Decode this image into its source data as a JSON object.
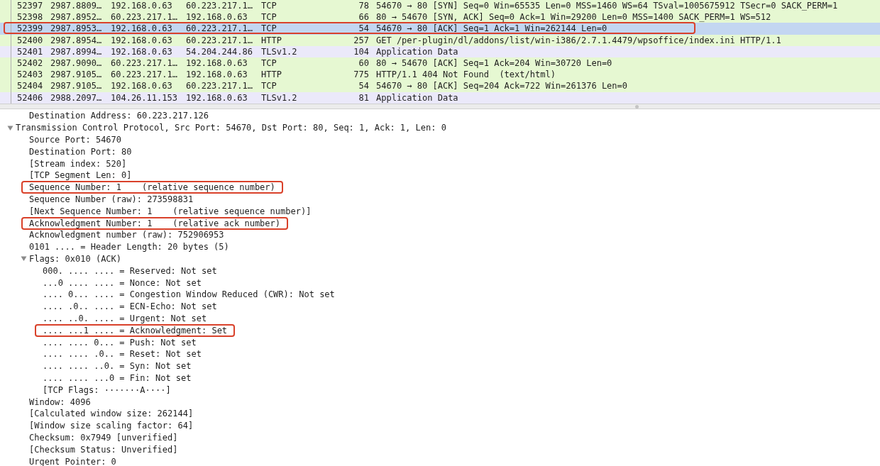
{
  "packets": [
    {
      "no": "52397",
      "time": "2987.8809…",
      "source": "192.168.0.63",
      "destination": "60.223.217.1…",
      "protocol": "TCP",
      "length": "78",
      "info": "54670 → 80 [SYN] Seq=0 Win=65535 Len=0 MSS=1460 WS=64 TSval=1005675912 TSecr=0 SACK_PERM=1",
      "color": "#e6f8d2",
      "selected": false,
      "highlighted": false
    },
    {
      "no": "52398",
      "time": "2987.8952…",
      "source": "60.223.217.1…",
      "destination": "192.168.0.63",
      "protocol": "TCP",
      "length": "66",
      "info": "80 → 54670 [SYN, ACK] Seq=0 Ack=1 Win=29200 Len=0 MSS=1400 SACK_PERM=1 WS=512",
      "color": "#e6f8d2",
      "selected": false,
      "highlighted": false
    },
    {
      "no": "52399",
      "time": "2987.8953…",
      "source": "192.168.0.63",
      "destination": "60.223.217.1…",
      "protocol": "TCP",
      "length": "54",
      "info": "54670 → 80 [ACK] Seq=1 Ack=1 Win=262144 Len=0",
      "selected": true,
      "highlighted": true
    },
    {
      "no": "52400",
      "time": "2987.8954…",
      "source": "192.168.0.63",
      "destination": "60.223.217.1…",
      "protocol": "HTTP",
      "length": "257",
      "info": "GET /per-plugin/dl/addons/list/win-i386/2.7.1.4479/wpsoffice/index.ini HTTP/1.1",
      "color": "#e6f8d2",
      "selected": false,
      "highlighted": false
    },
    {
      "no": "52401",
      "time": "2987.8994…",
      "source": "192.168.0.63",
      "destination": "54.204.244.86",
      "protocol": "TLSv1.2",
      "length": "104",
      "info": "Application Data",
      "color": "#ebe9fa",
      "selected": false,
      "highlighted": false
    },
    {
      "no": "52402",
      "time": "2987.9090…",
      "source": "60.223.217.1…",
      "destination": "192.168.0.63",
      "protocol": "TCP",
      "length": "60",
      "info": "80 → 54670 [ACK] Seq=1 Ack=204 Win=30720 Len=0",
      "color": "#e6f8d2",
      "selected": false,
      "highlighted": false
    },
    {
      "no": "52403",
      "time": "2987.9105…",
      "source": "60.223.217.1…",
      "destination": "192.168.0.63",
      "protocol": "HTTP",
      "length": "775",
      "info": "HTTP/1.1 404 Not Found  (text/html)",
      "color": "#e6f8d2",
      "selected": false,
      "highlighted": false
    },
    {
      "no": "52404",
      "time": "2987.9105…",
      "source": "192.168.0.63",
      "destination": "60.223.217.1…",
      "protocol": "TCP",
      "length": "54",
      "info": "54670 → 80 [ACK] Seq=204 Ack=722 Win=261376 Len=0",
      "color": "#e6f8d2",
      "selected": false,
      "highlighted": false
    },
    {
      "no": "52406",
      "time": "2988.2097…",
      "source": "104.26.11.153",
      "destination": "192.168.0.63",
      "protocol": "TLSv1.2",
      "length": "81",
      "info": "Application Data",
      "color": "#ebe9fa",
      "selected": false,
      "highlighted": false
    }
  ],
  "details": [
    {
      "children": [
        {
          "text": "Destination Address: 60.223.217.126",
          "highlighted": false
        }
      ]
    },
    {
      "text": "Transmission Control Protocol, Src Port: 54670, Dst Port: 80, Seq: 1, Ack: 1, Len: 0",
      "highlighted": false,
      "expanded": true,
      "children": [
        {
          "text": "Source Port: 54670",
          "highlighted": false
        },
        {
          "text": "Destination Port: 80",
          "highlighted": false
        },
        {
          "text": "[Stream index: 520]",
          "highlighted": false
        },
        {
          "text": "[TCP Segment Len: 0]",
          "highlighted": false
        },
        {
          "text": "Sequence Number: 1    (relative sequence number)",
          "highlighted": true
        },
        {
          "text": "Sequence Number (raw): 273598831",
          "highlighted": false
        },
        {
          "text": "[Next Sequence Number: 1    (relative sequence number)]",
          "highlighted": false
        },
        {
          "text": "Acknowledgment Number: 1    (relative ack number)",
          "highlighted": true
        },
        {
          "text": "Acknowledgment number (raw): 752906953",
          "highlighted": false
        },
        {
          "text": "0101 .... = Header Length: 20 bytes (5)",
          "highlighted": false
        },
        {
          "text": "Flags: 0x010 (ACK)",
          "highlighted": false,
          "expanded": true,
          "children": [
            {
              "text": "000. .... .... = Reserved: Not set",
              "highlighted": false
            },
            {
              "text": "...0 .... .... = Nonce: Not set",
              "highlighted": false
            },
            {
              "text": ".... 0... .... = Congestion Window Reduced (CWR): Not set",
              "highlighted": false
            },
            {
              "text": ".... .0.. .... = ECN-Echo: Not set",
              "highlighted": false
            },
            {
              "text": ".... ..0. .... = Urgent: Not set",
              "highlighted": false
            },
            {
              "text": ".... ...1 .... = Acknowledgment: Set",
              "highlighted": true
            },
            {
              "text": ".... .... 0... = Push: Not set",
              "highlighted": false
            },
            {
              "text": ".... .... .0.. = Reset: Not set",
              "highlighted": false
            },
            {
              "text": ".... .... ..0. = Syn: Not set",
              "highlighted": false
            },
            {
              "text": ".... .... ...0 = Fin: Not set",
              "highlighted": false
            },
            {
              "text": "[TCP Flags: ·······A····]",
              "highlighted": false
            }
          ]
        },
        {
          "text": "Window: 4096",
          "highlighted": false
        },
        {
          "text": "[Calculated window size: 262144]",
          "highlighted": false
        },
        {
          "text": "[Window size scaling factor: 64]",
          "highlighted": false
        },
        {
          "text": "Checksum: 0x7949 [unverified]",
          "highlighted": false
        },
        {
          "text": "[Checksum Status: Unverified]",
          "highlighted": false
        },
        {
          "text": "Urgent Pointer: 0",
          "highlighted": false
        }
      ]
    }
  ]
}
